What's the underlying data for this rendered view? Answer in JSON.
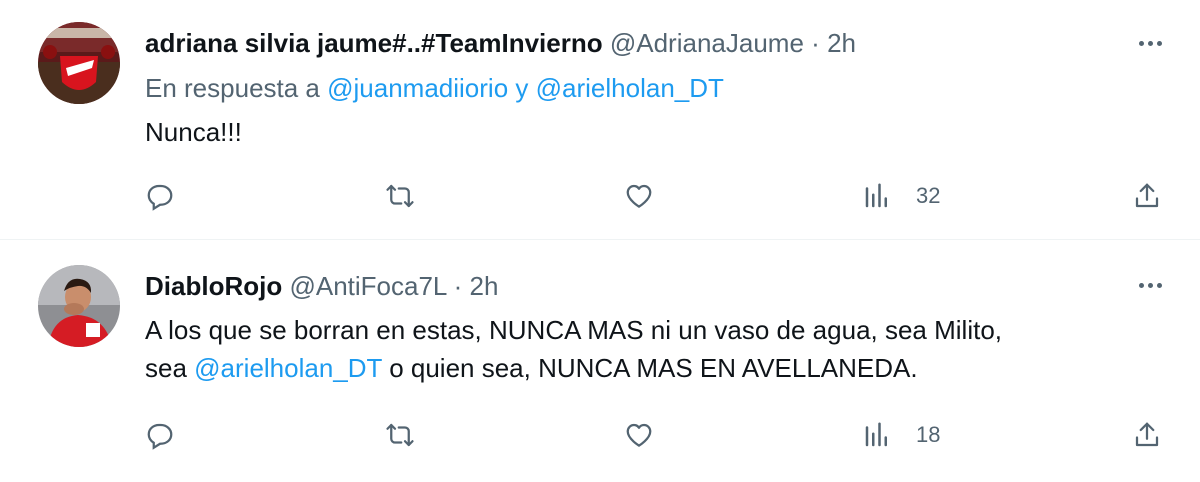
{
  "tweets": [
    {
      "display_name": "adriana silvia jaume#..#TeamInvierno",
      "handle": "@AdrianaJaume",
      "separator": "·",
      "time": "2h",
      "reply_prefix": "En respuesta a",
      "reply_to_1": "@juanmadiiorio",
      "reply_joiner": "y",
      "reply_to_2": "@arielholan_DT",
      "text": "Nunca!!!",
      "views": "32",
      "avatar_icon": "team-flag-avatar"
    },
    {
      "display_name": "DiabloRojo",
      "handle": "@AntiFoca7L",
      "separator": "·",
      "time": "2h",
      "text_line1": "A los que se borran en estas, NUNCA MAS ni un vaso de agua, sea Milito,",
      "text_line2_prefix": "sea",
      "text_mention": "@arielholan_DT",
      "text_line2_suffix": "o quien sea, NUNCA MAS EN AVELLANEDA.",
      "views": "18",
      "avatar_icon": "player-avatar"
    }
  ],
  "colors": {
    "text": "#0f1419",
    "secondary": "#536471",
    "link": "#1d9bf0",
    "divider": "#eff3f4"
  },
  "icons": [
    "reply-icon",
    "retweet-icon",
    "like-icon",
    "views-icon",
    "share-icon",
    "more-icon"
  ]
}
